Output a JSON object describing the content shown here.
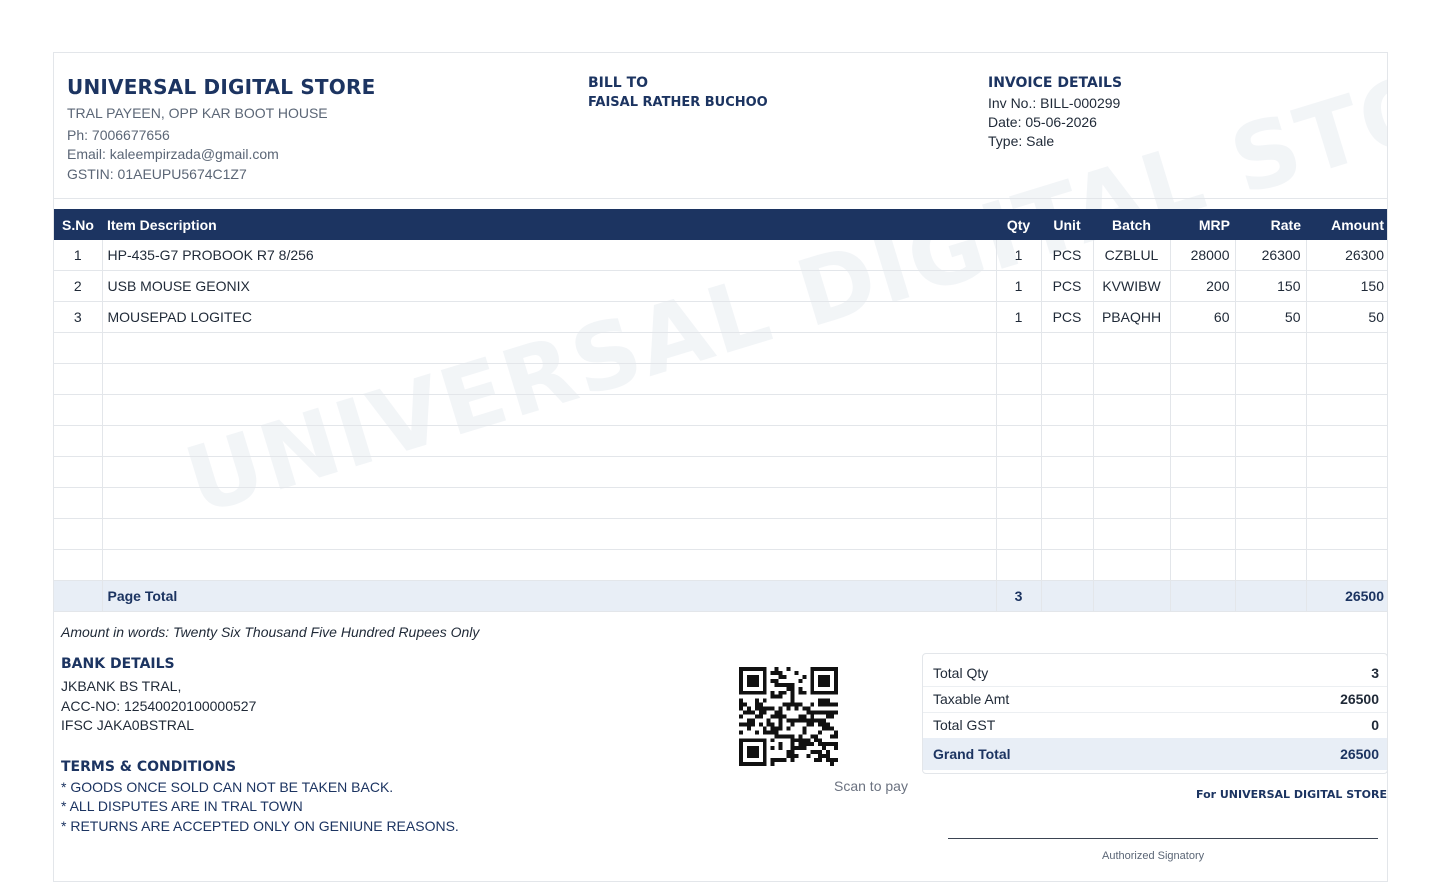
{
  "watermark": "UNIVERSAL DIGITAL STORE",
  "store": {
    "name": "UNIVERSAL DIGITAL STORE",
    "address": "TRAL PAYEEN, OPP KAR BOOT HOUSE",
    "phone": "Ph: 7006677656",
    "email": "Email: kaleempirzada@gmail.com",
    "gstin": "GSTIN: 01AEUPU5674C1Z7"
  },
  "bill_to": {
    "heading": "BILL TO",
    "name": "FAISAL RATHER BUCHOO"
  },
  "invoice": {
    "heading": "INVOICE DETAILS",
    "number": "Inv No.: BILL-000299",
    "date": "Date: 05-06-2026",
    "type": "Type: Sale"
  },
  "table": {
    "headers": {
      "sno": "S.No",
      "desc": "Item Description",
      "qty": "Qty",
      "unit": "Unit",
      "batch": "Batch",
      "mrp": "MRP",
      "rate": "Rate",
      "amount": "Amount"
    },
    "rows": [
      {
        "sno": "1",
        "desc": "HP-435-G7 PROBOOK R7 8/256",
        "qty": "1",
        "unit": "PCS",
        "batch": "CZBLUL",
        "mrp": "28000",
        "rate": "26300",
        "amount": "26300"
      },
      {
        "sno": "2",
        "desc": "USB MOUSE GEONIX",
        "qty": "1",
        "unit": "PCS",
        "batch": "KVWIBW",
        "mrp": "200",
        "rate": "150",
        "amount": "150"
      },
      {
        "sno": "3",
        "desc": "MOUSEPAD LOGITEC",
        "qty": "1",
        "unit": "PCS",
        "batch": "PBAQHH",
        "mrp": "60",
        "rate": "50",
        "amount": "50"
      }
    ],
    "page_total": {
      "label": "Page Total",
      "qty": "3",
      "amount": "26500"
    }
  },
  "amount_in_words": "Amount in words: Twenty Six Thousand Five Hundred Rupees Only",
  "bank": {
    "heading": "BANK DETAILS",
    "lines": [
      "JKBANK BS TRAL,",
      "ACC-NO: 12540020100000527",
      "IFSC JAKA0BSTRAL"
    ]
  },
  "terms": {
    "heading": "TERMS & CONDITIONS",
    "lines": [
      "* GOODS ONCE SOLD CAN NOT BE TAKEN BACK.",
      "* ALL DISPUTES ARE IN TRAL TOWN",
      "* RETURNS ARE ACCEPTED ONLY ON GENIUNE REASONS."
    ]
  },
  "qr": {
    "caption": "Scan to pay"
  },
  "totals": {
    "total_qty_label": "Total Qty",
    "total_qty": "3",
    "taxable_label": "Taxable Amt",
    "taxable": "26500",
    "gst_label": "Total GST",
    "gst": "0",
    "grand_label": "Grand Total",
    "grand": "26500"
  },
  "signature": {
    "for_store": "For UNIVERSAL DIGITAL STORE",
    "label": "Authorized Signatory"
  },
  "colors": {
    "brand": "#1c3461",
    "total_bg": "#e8eef6"
  }
}
